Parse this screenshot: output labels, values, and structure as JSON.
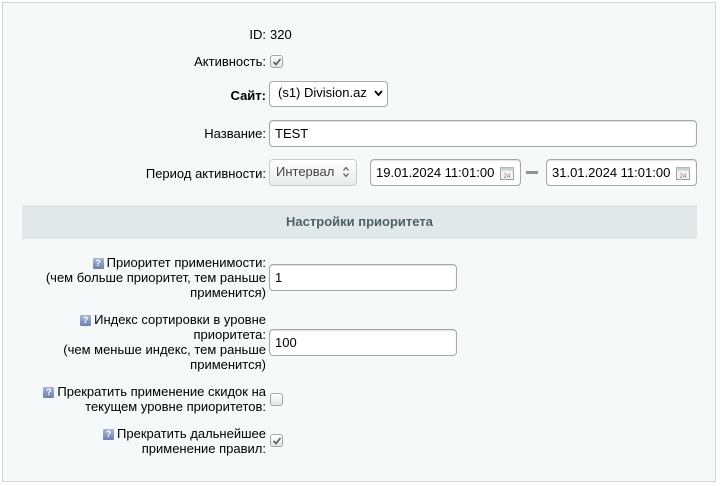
{
  "form": {
    "id_label": "ID:",
    "id_value": "320",
    "active_label": "Активность:",
    "active_checked": true,
    "site_label": "Сайт:",
    "site_value": "(s1) Division.az",
    "name_label": "Название:",
    "name_value": "TEST",
    "period_label": "Период активности:",
    "period_type": "Интервал",
    "date_from": "19.01.2024 11:01:00",
    "date_to": "31.01.2024 11:01:00"
  },
  "priority_section": {
    "title": "Настройки приоритета",
    "priority_label_1": "Приоритет применимости:",
    "priority_label_2": "(чем больше приоритет, тем раньше",
    "priority_label_3": "применится)",
    "priority_value": "1",
    "sort_label_1": "Индекс сортировки в уровне",
    "sort_label_2": "приоритета:",
    "sort_label_3": "(чем меньше индекс, тем раньше",
    "sort_label_4": "применится)",
    "sort_value": "100",
    "stop_level_label_1": "Прекратить применение скидок на",
    "stop_level_label_2": "текущем уровне приоритетов:",
    "stop_level_checked": false,
    "stop_further_label_1": "Прекратить дальнейшее",
    "stop_further_label_2": "применение правил:",
    "stop_further_checked": true,
    "help_icon_text": "?"
  }
}
